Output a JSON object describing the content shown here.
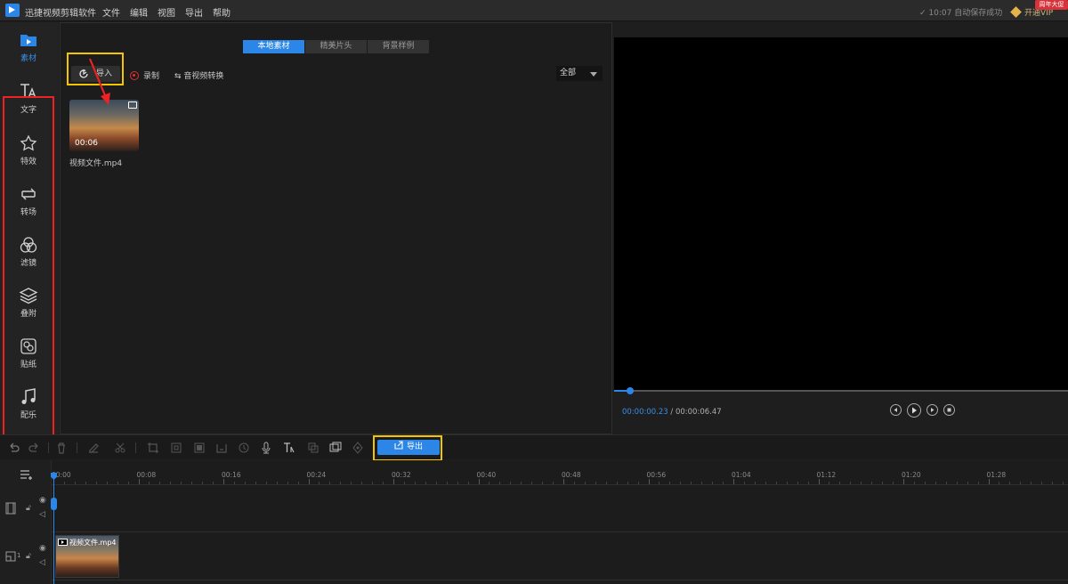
{
  "titlebar": {
    "app_title": "迅捷视频剪辑软件",
    "menu": [
      "文件",
      "编辑",
      "视图",
      "导出",
      "帮助"
    ],
    "autosave": "10:07 自动保存成功",
    "vip": "开通VIP",
    "promo_badge": "周年大促"
  },
  "sidebar": {
    "items": [
      {
        "label": "素材",
        "icon": "folder-play-icon"
      },
      {
        "label": "文字",
        "icon": "text-icon"
      },
      {
        "label": "特效",
        "icon": "star-effect-icon"
      },
      {
        "label": "转场",
        "icon": "transition-icon"
      },
      {
        "label": "滤镜",
        "icon": "filter-circles-icon"
      },
      {
        "label": "叠附",
        "icon": "layers-icon"
      },
      {
        "label": "贴纸",
        "icon": "sticker-icon"
      },
      {
        "label": "配乐",
        "icon": "music-note-icon"
      }
    ]
  },
  "media": {
    "tabs": [
      "本地素材",
      "精美片头",
      "背景样例"
    ],
    "import_label": "导入",
    "record_label": "录制",
    "convert_label": "音视频转换",
    "filter_value": "全部",
    "items": [
      {
        "duration": "00:06",
        "name": "视频文件.mp4"
      }
    ]
  },
  "preview": {
    "current_time": "00:00:00.23",
    "total_time": "/ 00:00:06.47",
    "progress": 0.036
  },
  "toolbar": {
    "export_label": "导出"
  },
  "timeline": {
    "ticks": [
      "00:00",
      "00:08",
      "00:16",
      "00:24",
      "00:32",
      "00:40",
      "00:48",
      "00:56",
      "01:04",
      "01:12",
      "01:20",
      "01:28"
    ],
    "clip_name": "视频文件.mp4",
    "track2_label": "1"
  },
  "colors": {
    "accent": "#2b86e8",
    "highlight_yellow": "#f2c500",
    "highlight_red": "#ee2222"
  }
}
